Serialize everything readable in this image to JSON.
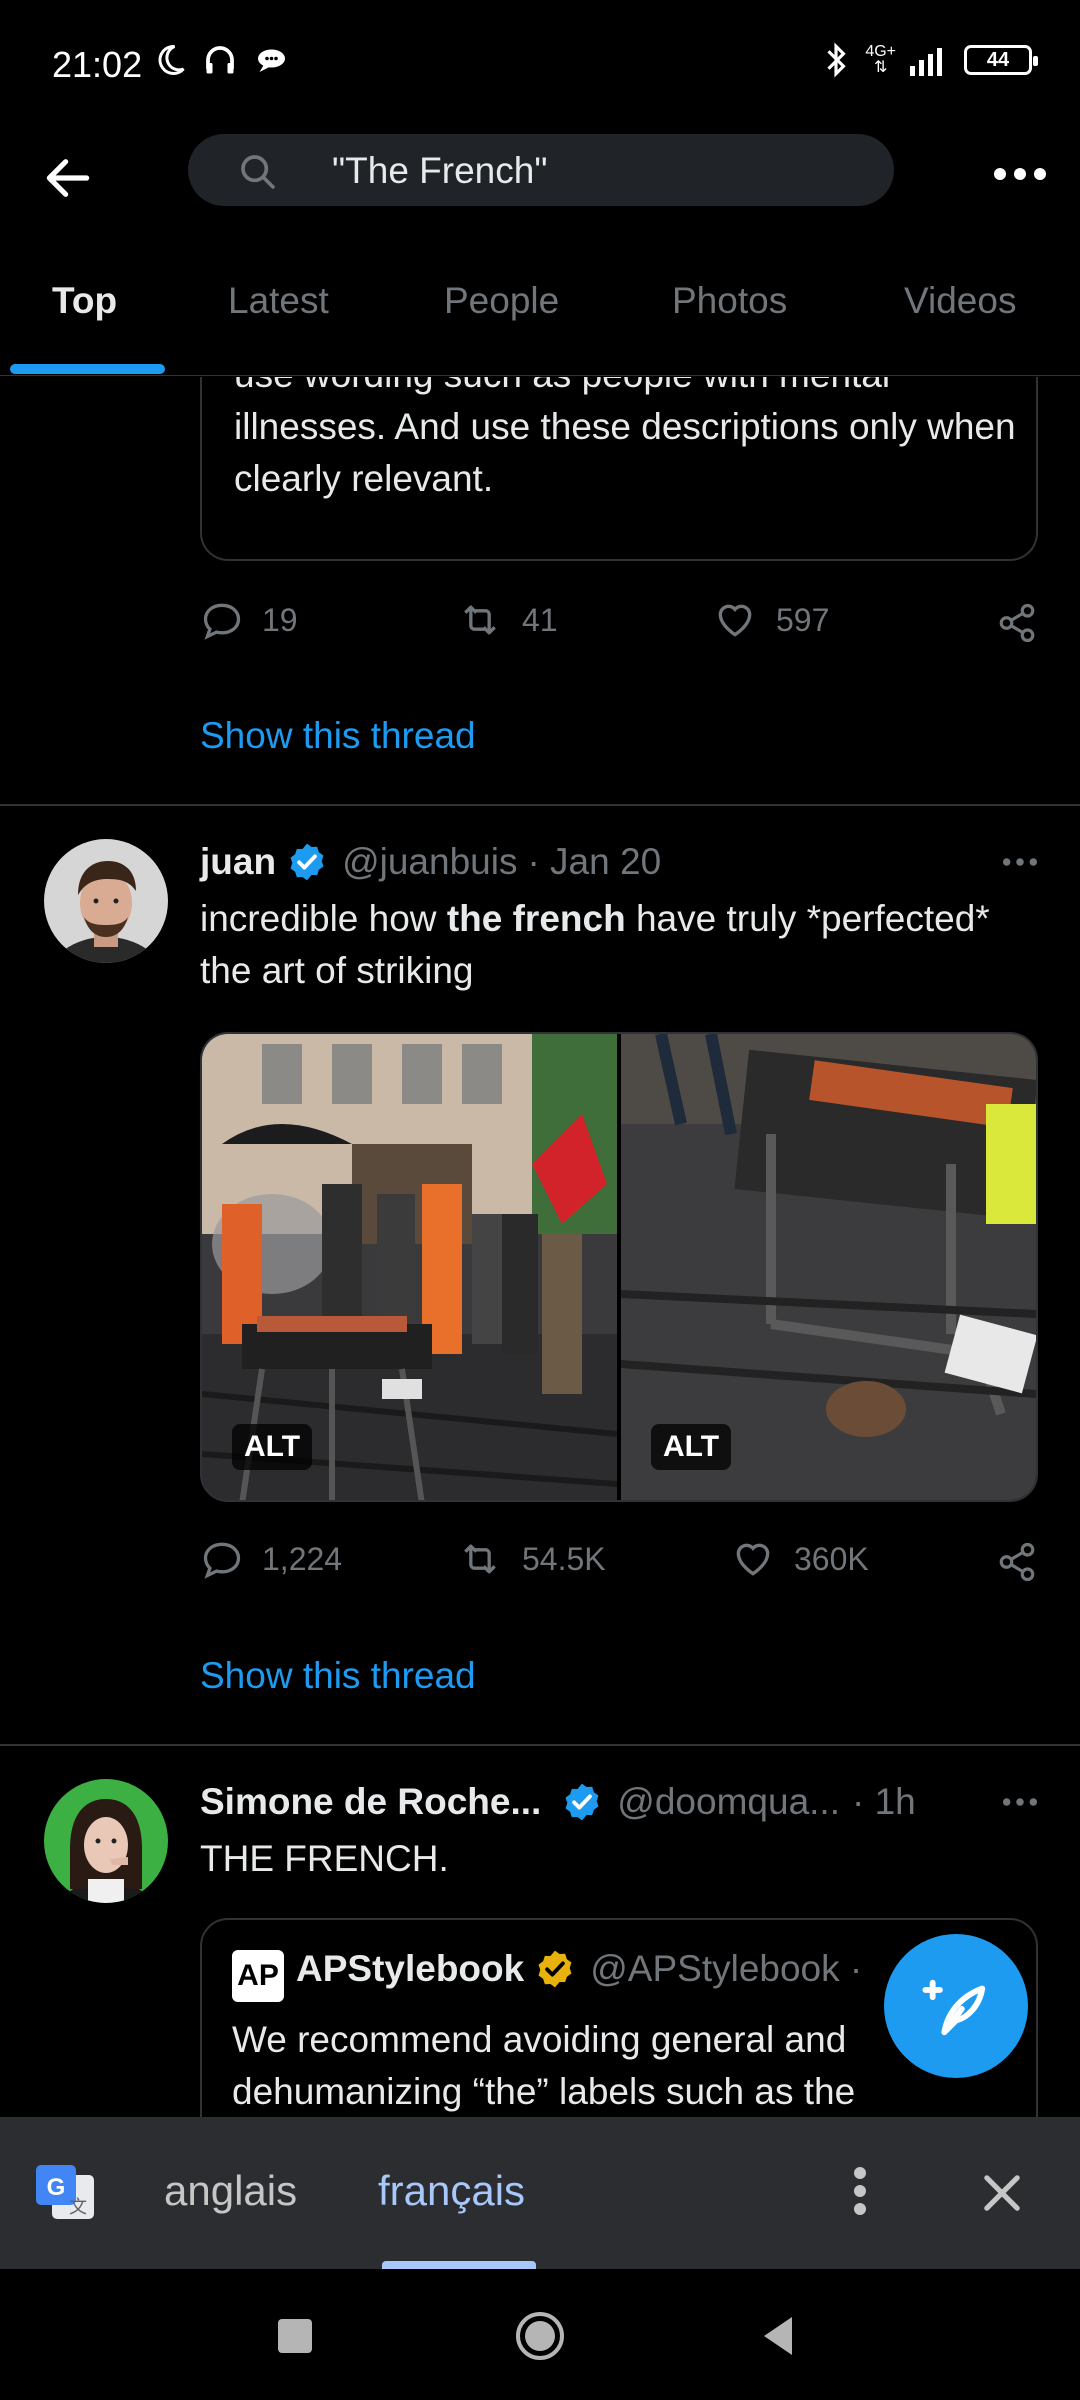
{
  "status_bar": {
    "time": "21:02",
    "network": "4G+",
    "battery": "44"
  },
  "search": {
    "query": "\"The French\""
  },
  "tabs": [
    {
      "label": "Top",
      "active": true
    },
    {
      "label": "Latest",
      "active": false
    },
    {
      "label": "People",
      "active": false
    },
    {
      "label": "Photos",
      "active": false
    },
    {
      "label": "Videos",
      "active": false
    }
  ],
  "thread1": {
    "quote_text": "use wording such as people with mental illnesses. And use these descriptions only when clearly relevant.",
    "replies": "19",
    "retweets": "41",
    "likes": "597",
    "show_thread": "Show this thread"
  },
  "tweet2": {
    "name": "juan",
    "handle": "@juanbuis",
    "time": "· Jan 20",
    "text_before": "incredible how ",
    "text_bold": "the french",
    "text_after": " have truly *perfected* the art of striking",
    "photos": [
      {
        "alt_label": "ALT"
      },
      {
        "alt_label": "ALT"
      }
    ],
    "replies": "1,224",
    "retweets": "54.5K",
    "likes": "360K",
    "show_thread": "Show this thread"
  },
  "tweet3": {
    "name": "Simone de Roche...",
    "handle": "@doomqua...",
    "time": "· 1h",
    "text": "THE FRENCH.",
    "quote": {
      "logo_text": "AP",
      "name": "APStylebook",
      "handle": "@APStylebook ·",
      "text": "We recommend avoiding general and dehumanizing “the” labels such as the"
    }
  },
  "translate_bar": {
    "source_lang": "anglais",
    "target_lang": "français",
    "active": "français"
  },
  "colors": {
    "accent": "#1d9bf0",
    "background": "#000000",
    "muted": "#71767b",
    "border": "#2f3336",
    "translate_active": "#a8c7fa"
  }
}
